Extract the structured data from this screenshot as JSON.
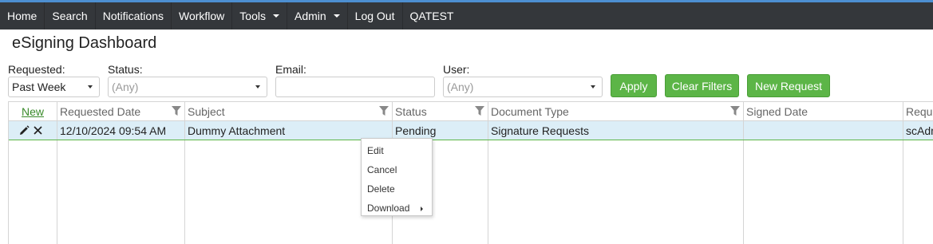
{
  "nav": {
    "items": [
      {
        "label": "Home",
        "dropdown": false
      },
      {
        "label": "Search",
        "dropdown": false
      },
      {
        "label": "Notifications",
        "dropdown": false
      },
      {
        "label": "Workflow",
        "dropdown": false
      },
      {
        "label": "Tools",
        "dropdown": true
      },
      {
        "label": "Admin",
        "dropdown": true
      },
      {
        "label": "Log Out",
        "dropdown": false
      }
    ],
    "user": "QATEST"
  },
  "page": {
    "title": "eSigning Dashboard"
  },
  "filters": {
    "requested_label": "Requested:",
    "requested_value": "Past Week",
    "status_label": "Status:",
    "status_placeholder": "(Any)",
    "email_label": "Email:",
    "email_value": "",
    "user_label": "User:",
    "user_placeholder": "(Any)"
  },
  "buttons": {
    "apply": "Apply",
    "clear_filters": "Clear Filters",
    "new_request": "New Request"
  },
  "grid": {
    "new_link": "New",
    "columns": [
      "Requested Date",
      "Subject",
      "Status",
      "Document Type",
      "Signed Date",
      "Reque"
    ],
    "rows": [
      {
        "requested_date": "12/10/2024 09:54 AM",
        "subject": "Dummy Attachment",
        "status": "Pending",
        "document_type": "Signature Requests",
        "signed_date": "",
        "requested_by": "scAdm"
      }
    ]
  },
  "context_menu": {
    "items": [
      "Edit",
      "Cancel",
      "Delete",
      "Download"
    ]
  },
  "colors": {
    "nav_bg": "#34373b",
    "accent_green": "#5cb547",
    "row_selected": "#dceef7"
  },
  "icons": {
    "filter": "funnel-icon",
    "edit": "pencil-icon",
    "delete": "x-icon",
    "dropdown": "caret-down-icon",
    "submenu": "caret-right-icon"
  }
}
